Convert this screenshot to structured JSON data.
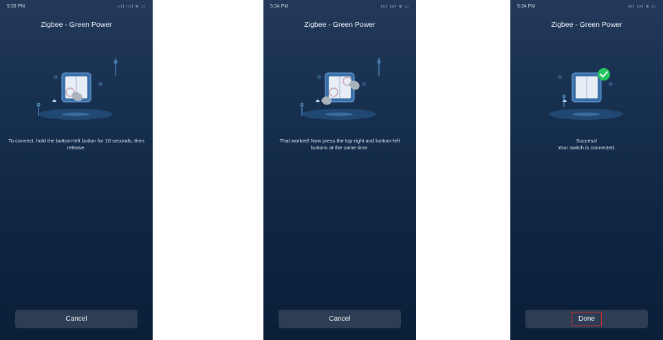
{
  "screens": [
    {
      "time": "5:39 PM",
      "status_icons": "ıııl ıııl ≋ ▭",
      "title": "Zigbee - Green Power",
      "message": "To connect, hold the bottom-left button for 10 seconds, then release.",
      "button_label": "Cancel",
      "illustration": "switch-press-bottom-left-icon"
    },
    {
      "time": "5:34 PM",
      "status_icons": "ıııl ıııl ≋ ▭",
      "title": "Zigbee - Green Power",
      "message": "That worked! Now press the top-right and bottom-left buttons at the same time.",
      "button_label": "Cancel",
      "illustration": "switch-press-two-buttons-icon"
    },
    {
      "time": "5:34 PM",
      "status_icons": "ıııl ıııl ≋ ▭",
      "title": "Zigbee - Green Power",
      "message": "Success!\nYour switch is connected.",
      "button_label": "Done",
      "illustration": "switch-connected-check-icon"
    }
  ],
  "colors": {
    "accent_success": "#22c55e",
    "highlight_border": "#e0262a"
  }
}
